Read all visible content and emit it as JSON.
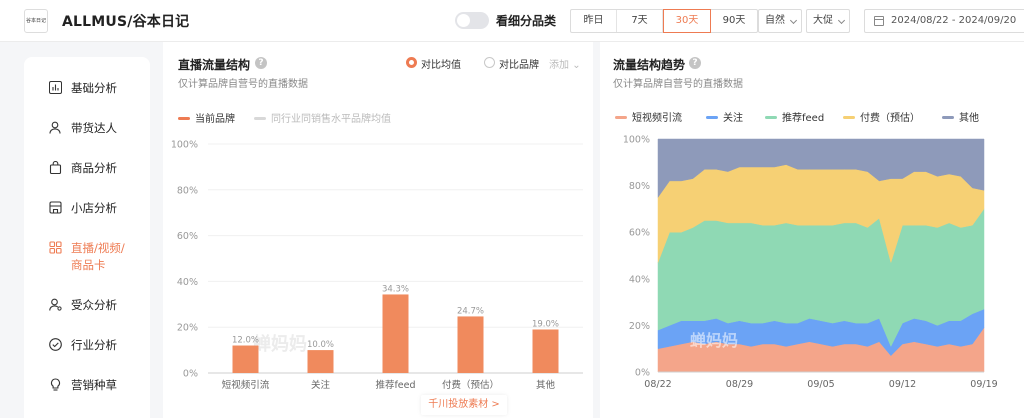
{
  "header": {
    "logo_text": "谷本日记",
    "brand": "ALLMUS/谷本日记",
    "toggle_label": "看细分品类",
    "time_tabs": [
      "昨日",
      "7天",
      "30天",
      "90天"
    ],
    "active_time_tab": "30天",
    "dropdowns": [
      "自然",
      "大促"
    ],
    "date_range": "2024/08/22 - 2024/09/20"
  },
  "sidebar": {
    "items": [
      {
        "label": "基础分析",
        "icon": "bar-chart-icon"
      },
      {
        "label": "带货达人",
        "icon": "person-icon"
      },
      {
        "label": "商品分析",
        "icon": "bag-icon"
      },
      {
        "label": "小店分析",
        "icon": "store-icon"
      },
      {
        "label": "直播/视频/",
        "label2": "商品卡",
        "icon": "live-icon",
        "active": true
      },
      {
        "label": "受众分析",
        "icon": "audience-icon"
      },
      {
        "label": "行业分析",
        "icon": "check-circle-icon"
      },
      {
        "label": "营销种草",
        "icon": "bulb-icon"
      }
    ]
  },
  "left_panel": {
    "title": "直播流量结构",
    "subtitle": "仅计算品牌自营号的直播数据",
    "radio_1": "对比均值",
    "radio_2": "对比品牌",
    "add_label": "添加",
    "legend_current": "当前品牌",
    "legend_compare": "同行业同销售水平品牌均值",
    "watermark": "蝉妈妈",
    "link_label": "千川投放素材 >"
  },
  "right_panel": {
    "title": "流量结构趋势",
    "subtitle": "仅计算品牌自营号的直播数据",
    "watermark": "蝉妈妈"
  },
  "colors": {
    "accent": "#ee7b52",
    "bar": "#f08a5d",
    "compare": "#d8d8d8"
  },
  "chart_data": [
    {
      "type": "bar",
      "categories": [
        "短视频引流",
        "关注",
        "推荐feed",
        "付费（预估）",
        "其他"
      ],
      "series": [
        {
          "name": "当前品牌",
          "values": [
            12.0,
            10.0,
            34.3,
            24.7,
            19.0
          ]
        }
      ],
      "data_labels": [
        "12.0%",
        "10.0%",
        "34.3%",
        "24.7%",
        "19.0%"
      ],
      "yticks": [
        "0%",
        "20%",
        "40%",
        "60%",
        "80%",
        "100%"
      ],
      "ylim": [
        0,
        100
      ],
      "legend_position": "top-left",
      "grid": true
    },
    {
      "type": "area",
      "stacked": true,
      "x": [
        "08/22",
        "08/23",
        "08/24",
        "08/25",
        "08/26",
        "08/27",
        "08/28",
        "08/29",
        "08/30",
        "08/31",
        "09/01",
        "09/02",
        "09/03",
        "09/04",
        "09/05",
        "09/06",
        "09/07",
        "09/08",
        "09/09",
        "09/10",
        "09/11",
        "09/12",
        "09/13",
        "09/14",
        "09/15",
        "09/16",
        "09/17",
        "09/18",
        "09/19"
      ],
      "xticks": [
        "08/22",
        "08/29",
        "09/05",
        "09/12",
        "09/19"
      ],
      "yticks": [
        "0%",
        "20%",
        "40%",
        "60%",
        "80%",
        "100%"
      ],
      "ylim": [
        0,
        100
      ],
      "legend_position": "top",
      "series": [
        {
          "name": "短视频引流",
          "color": "#f4a58a",
          "values": [
            10,
            11,
            12,
            13,
            12,
            13,
            12,
            12,
            11,
            12,
            12,
            11,
            12,
            13,
            12,
            11,
            12,
            12,
            11,
            13,
            7,
            12,
            13,
            12,
            11,
            12,
            11,
            12,
            19
          ]
        },
        {
          "name": "关注",
          "color": "#6ba3f5",
          "values": [
            8,
            9,
            10,
            9,
            10,
            10,
            9,
            10,
            10,
            9,
            10,
            10,
            9,
            10,
            10,
            10,
            10,
            9,
            10,
            10,
            4,
            9,
            10,
            10,
            9,
            10,
            11,
            13,
            8
          ]
        },
        {
          "name": "推荐feed",
          "color": "#8fd9b4",
          "values": [
            29,
            40,
            38,
            40,
            43,
            42,
            43,
            42,
            43,
            42,
            41,
            43,
            42,
            40,
            41,
            42,
            42,
            43,
            41,
            43,
            36,
            42,
            40,
            41,
            42,
            42,
            40,
            38,
            43
          ]
        },
        {
          "name": "付费（预估）",
          "color": "#f6d074",
          "values": [
            28,
            22,
            22,
            21,
            22,
            22,
            22,
            24,
            24,
            25,
            25,
            25,
            24,
            24,
            24,
            24,
            23,
            23,
            24,
            16,
            36,
            20,
            23,
            23,
            22,
            21,
            22,
            16,
            8
          ]
        },
        {
          "name": "其他",
          "color": "#8e9aba",
          "values": [
            25,
            18,
            18,
            17,
            13,
            13,
            14,
            12,
            12,
            12,
            12,
            11,
            13,
            13,
            13,
            13,
            13,
            13,
            14,
            18,
            17,
            17,
            14,
            14,
            16,
            15,
            16,
            21,
            22
          ]
        }
      ]
    }
  ]
}
